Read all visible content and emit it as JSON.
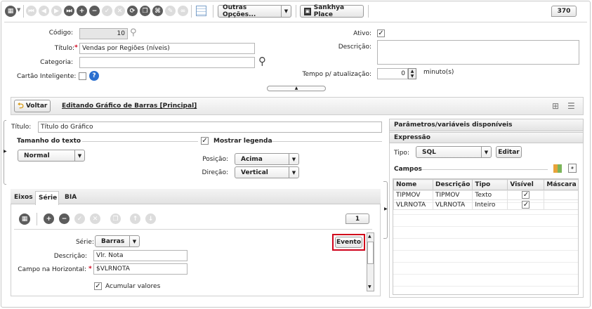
{
  "toolbar": {
    "outras_opcoes": "Outras Opções...",
    "sankhya_place": "Sankhya Place",
    "record_count": "370"
  },
  "form": {
    "codigo_label": "Código:",
    "codigo_value": "10",
    "titulo_label": "Título:",
    "titulo_value": "Vendas por Regiões (níveis)",
    "categoria_label": "Categoria:",
    "categoria_value": "",
    "cartao_label": "Cartão Inteligente:",
    "ativo_label": "Ativo:",
    "descricao_label": "Descrição:",
    "tempo_label": "Tempo p/ atualização:",
    "tempo_value": "0",
    "tempo_unit": "minuto(s)"
  },
  "editor": {
    "voltar_label": "Voltar",
    "editing_title": "Editando Gráfico de Barras [Principal]",
    "titulo_label": "Título:",
    "titulo_value": "Título do Gráfico",
    "tamanho_label": "Tamanho do texto",
    "tamanho_value": "Normal",
    "mostrar_legenda": "Mostrar legenda",
    "posicao_label": "Posição:",
    "posicao_value": "Acima",
    "direcao_label": "Direção:",
    "direcao_value": "Vertical"
  },
  "tabs": [
    "Eixos",
    "Série",
    "BIA"
  ],
  "serie": {
    "page": "1",
    "serie_label": "Série:",
    "serie_value": "Barras",
    "descricao_label": "Descrição:",
    "descricao_value": "Vlr. Nota",
    "campo_label": "Campo na Horizontal:",
    "campo_value": "$VLRNOTA",
    "acumular": "Acumular valores",
    "evento_label": "Evento"
  },
  "params": {
    "header": "Parâmetros/variáveis disponíveis",
    "expressao": "Expressão",
    "tipo_label": "Tipo:",
    "tipo_value": "SQL",
    "editar_label": "Editar",
    "campos_label": "Campos",
    "columns": [
      "Nome",
      "Descrição",
      "Tipo",
      "Visível",
      "Máscara"
    ],
    "rows": [
      {
        "nome": "TIPMOV",
        "descricao": "TIPMOV",
        "tipo": "Texto",
        "visivel": "✓",
        "mascara": ""
      },
      {
        "nome": "VLRNOTA",
        "descricao": "VLRNOTA",
        "tipo": "Inteiro",
        "visivel": "✓",
        "mascara": ""
      }
    ]
  },
  "colors": {
    "accent_blue": "#2a6fcf",
    "required": "#d0021b",
    "highlight": "#d0021b"
  }
}
